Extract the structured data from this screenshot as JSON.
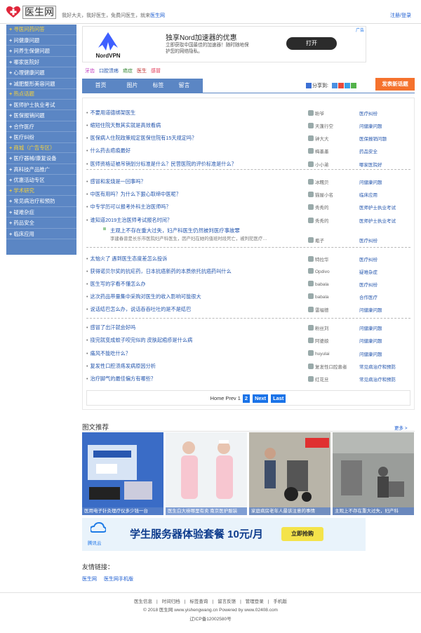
{
  "header": {
    "logo_text": "医生网",
    "tagline": "我好大夫，我好医生，免费问医生，就来",
    "tagline_link": "医生网",
    "login": "注册/登录"
  },
  "sidebar": [
    {
      "type": "sec",
      "label": "寻医问药问答"
    },
    {
      "type": "it",
      "label": "问健康问题"
    },
    {
      "type": "it",
      "label": "问养生保健问题"
    },
    {
      "type": "it",
      "label": "哪家医院好"
    },
    {
      "type": "it",
      "label": "心理健康问题"
    },
    {
      "type": "it",
      "label": "减肥整形美容问题"
    },
    {
      "type": "sec",
      "label": "热点话题"
    },
    {
      "type": "it",
      "label": "医师护士执业考试"
    },
    {
      "type": "it",
      "label": "医保报销问题"
    },
    {
      "type": "it",
      "label": "合作医疗"
    },
    {
      "type": "it",
      "label": "医疗纠纷"
    },
    {
      "type": "sec",
      "label": "商城（广告专区）"
    },
    {
      "type": "it",
      "label": "医疗器械/康复设备"
    },
    {
      "type": "it",
      "label": "高科技产品推广"
    },
    {
      "type": "it",
      "label": "优惠活动专区"
    },
    {
      "type": "sec",
      "label": "学术研究"
    },
    {
      "type": "it",
      "label": "常见病治疗和预防"
    },
    {
      "type": "it",
      "label": "疑难杂症"
    },
    {
      "type": "it",
      "label": "药品安全"
    },
    {
      "type": "it",
      "label": "临床应用"
    }
  ],
  "ad_top": {
    "brand": "NordVPN",
    "title": "独享Nord加速器的优惠",
    "desc": "立即获取中国最佳的加速器！随时随地保护您的网络隐私。",
    "button": "打开",
    "ad_label": "广告"
  },
  "tags": [
    {
      "label": "牙齿",
      "color": "#c040c0"
    },
    {
      "label": "口腔溃疡",
      "color": "#2456ad"
    },
    {
      "label": "癌症",
      "color": "#3a8a3a"
    },
    {
      "label": "医生",
      "color": "#c03030"
    },
    {
      "label": "感冒",
      "color": "#e03050"
    }
  ],
  "tabs": [
    "首页",
    "图片",
    "标签",
    "留言"
  ],
  "share_label": "分享到:",
  "new_topic_button": "发表新话题",
  "list_rows": [
    {
      "title": "不要用道德绑架医生",
      "user": "盼爷",
      "cat": "医疗纠纷"
    },
    {
      "title": "缩短住院天数其实就是高效看病",
      "user": "天蓬行空",
      "cat": "问健康问题"
    },
    {
      "title": "医保病人住院政策规定医保住院有15天规定吗？",
      "user": "钟大大",
      "cat": "医保报销问题"
    },
    {
      "title": "什么药去疤痕最好",
      "user": "梅墨墨",
      "cat": "药品安全"
    },
    {
      "title": "医师资格证被吊销划分标准是什么？民营医院的评价标准是什么？",
      "user": "小小弟",
      "cat": "哪家医院好"
    },
    {
      "title": "感冒和发烧是一回事吗？",
      "user": "冰糯贝",
      "cat": "问健康问题"
    },
    {
      "title": "中医有用吗？为什么下狠心取缔中医呢？",
      "user": "猫屋小名",
      "cat": "临床应用"
    },
    {
      "title": "中专学历可以报考外科主治医师吗？",
      "user": "秀秀的",
      "cat": "医师护士执业考试"
    },
    {
      "title": "谁知道2019主治医师考试报名时间？",
      "user": "秀秀的",
      "cat": "医师护士执业考试"
    },
    {
      "title": "太恼火了 遇到医生态度差怎么投诉",
      "user": "特拉华",
      "cat": "医疗纠纷"
    },
    {
      "title": "获得诺贝尔奖的抗疟药，日本抗癌新药的本质依托抗癌药叫什么",
      "user": "Opdivo",
      "cat": "疑难杂症"
    },
    {
      "title": "医生写的字看不懂怎么办",
      "user": "babala",
      "cat": "医疗纠纷"
    },
    {
      "title": "这次药品带量集中采购对医生的收入影响可能很大",
      "user": "babala",
      "cat": "合作医疗"
    },
    {
      "title": "说话结巴怎么办，说话吞吞吐吐的是不是结巴",
      "user": "雷福德",
      "cat": "问健康问题"
    },
    {
      "title": "感冒了出汗就会好吗",
      "user": "粉丝刘",
      "cat": "问健康问题"
    },
    {
      "title": "挠完就变成蚊子咬完似的 皮肤起疱疹是什么病",
      "user": "阿婆娘",
      "cat": "问健康问题"
    },
    {
      "title": "痛风不能吃什么？",
      "user": "huyulai",
      "cat": "问健康问题"
    },
    {
      "title": "复发性口腔溃疡发病原因分析",
      "user": "复发性口腔患者",
      "cat": "常见病治疗和预防"
    },
    {
      "title": "治疗脚气的最佳偏方有哪些？",
      "user": "红花旦",
      "cat": "常见病治疗和预防"
    }
  ],
  "featured": {
    "title": "主观上不存在重大过失，妇产科医生仍然被判医疗事故罪",
    "desc": "李建春曾是长乐市医院妇产科医生，因产妇在她的值班时段死亡，被判犯医疗…",
    "user": "瓶子",
    "cat": "医疗纠纷"
  },
  "pager": {
    "home": "Home",
    "prev": "Prev",
    "p1": "1",
    "p2": "2",
    "next": "Next",
    "last": "Last"
  },
  "image_section": {
    "title": "图文推荐",
    "more": "更多 >",
    "items": [
      "医用电子针灸理疗仪多少钱一台",
      "医生白大褂哪里有卖 南京医护服装",
      "家庭病房老年人最该注意的事情",
      "主观上不存在重大过失，妇产科"
    ]
  },
  "ad_bottom": {
    "brand": "腾讯云",
    "title": "学生服务器体验套餐 10元/月",
    "button": "立即抢购"
  },
  "friends": {
    "title": "友情链接：",
    "links": [
      "医生网",
      "医生网手机版"
    ]
  },
  "footer": {
    "nav": [
      "医生信息",
      "时间归档",
      "标签查询",
      "留言反馈",
      "管理登录",
      "手机版"
    ],
    "copyright": "© 2018  医生网   www.yishengwang.cn   Powered by www.02408.com",
    "icp": "辽ICP备12002580号"
  }
}
